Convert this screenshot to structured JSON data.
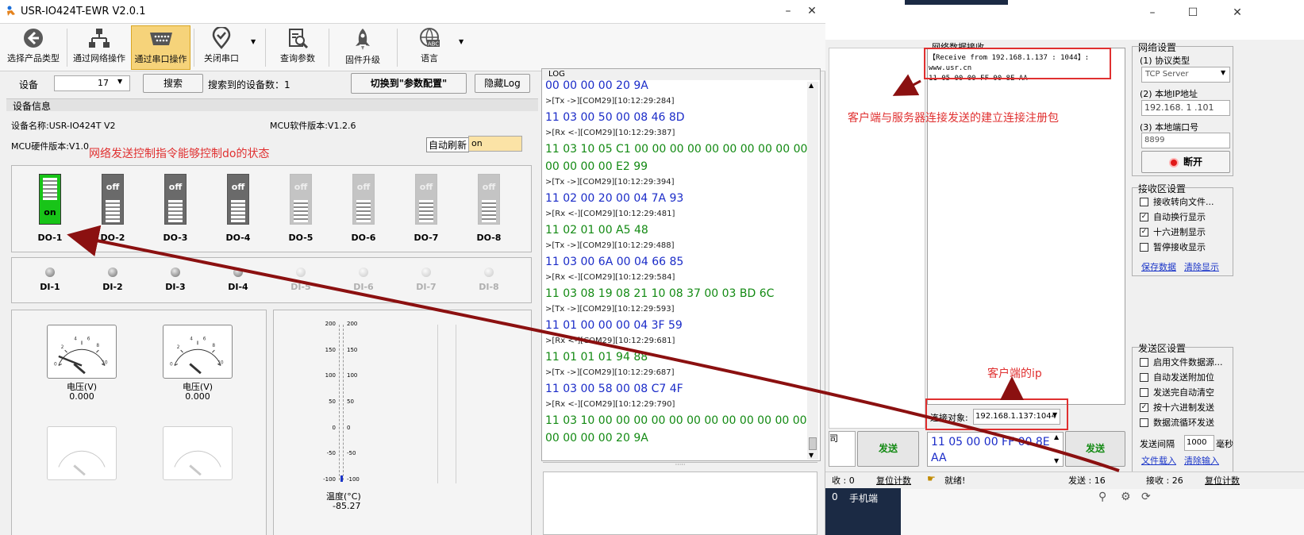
{
  "left_window": {
    "title": "USR-IO424T-EWR V2.0.1",
    "toolbar": [
      {
        "label": "选择产品类型",
        "icon": "back-arrow-icon"
      },
      {
        "label": "通过网络操作",
        "icon": "network-icon"
      },
      {
        "label": "通过串口操作",
        "icon": "serial-port-icon"
      },
      {
        "label": "关闭串口",
        "icon": "location-check-icon"
      },
      {
        "label": "查询参数",
        "icon": "search-document-icon"
      },
      {
        "label": "固件升级",
        "icon": "rocket-icon"
      },
      {
        "label": "语言",
        "icon": "globe-abc-icon"
      }
    ],
    "device_label": "设备",
    "device_value": "17",
    "search_button": "搜索",
    "found_label": "搜索到的设备数：1",
    "switch_button": "切换到\"参数配置\"",
    "hide_log_button": "隐藏Log",
    "device_info_title": "设备信息",
    "device_name": "设备名称:USR-IO424T V2",
    "mcu_soft": "MCU软件版本:V1.2.6",
    "mcu_hw": "MCU硬件版本:V1.0",
    "auto_refresh_label": "自动刷新",
    "auto_refresh_value": "on",
    "annotation_do": "网络发送控制指令能够控制do的状态",
    "do_switches": [
      {
        "label": "DO-1",
        "state": "on"
      },
      {
        "label": "DO-2",
        "state": "off"
      },
      {
        "label": "DO-3",
        "state": "off"
      },
      {
        "label": "DO-4",
        "state": "off"
      },
      {
        "label": "DO-5",
        "state": "off"
      },
      {
        "label": "DO-6",
        "state": "off"
      },
      {
        "label": "DO-7",
        "state": "off"
      },
      {
        "label": "DO-8",
        "state": "off"
      }
    ],
    "di_labels": [
      "DI-1",
      "DI-2",
      "DI-3",
      "DI-4",
      "DI-5",
      "DI-6",
      "DI-7",
      "DI-8"
    ],
    "gauges": [
      {
        "name": "电压(V)",
        "value": "0.000"
      },
      {
        "name": "电压(V)",
        "value": "0.000"
      }
    ],
    "thermo_ticks": [
      "200",
      "150",
      "100",
      "50",
      "0",
      "-50",
      "-100"
    ],
    "temp_label": "温度(°C)",
    "temp_value": "-85.27"
  },
  "log": {
    "title": "LOG",
    "lines": [
      {
        "type": "tx",
        "text": "00 00 00 00 20 9A"
      },
      {
        "type": "meta",
        "text": ">[Tx ->][COM29][10:12:29:284]"
      },
      {
        "type": "tx",
        "text": "11 03 00 50 00 08 46 8D"
      },
      {
        "type": "meta",
        "text": ">[Rx <-][COM29][10:12:29:387]"
      },
      {
        "type": "rx",
        "text": "11 03 10 05 C1 00 00 00 00 00 00 00 00 00 00"
      },
      {
        "type": "rx",
        "text": "00 00 00 00 E2 99"
      },
      {
        "type": "meta",
        "text": ">[Tx ->][COM29][10:12:29:394]"
      },
      {
        "type": "tx",
        "text": "11 02 00 20 00 04 7A 93"
      },
      {
        "type": "meta",
        "text": ">[Rx <-][COM29][10:12:29:481]"
      },
      {
        "type": "rx",
        "text": "11 02 01 00 A5 48"
      },
      {
        "type": "meta",
        "text": ">[Tx ->][COM29][10:12:29:488]"
      },
      {
        "type": "tx",
        "text": "11 03 00 6A 00 04 66 85"
      },
      {
        "type": "meta",
        "text": ">[Rx <-][COM29][10:12:29:584]"
      },
      {
        "type": "rx",
        "text": "11 03 08 19 08 21 10 08 37 00 03 BD 6C"
      },
      {
        "type": "meta",
        "text": ">[Tx ->][COM29][10:12:29:593]"
      },
      {
        "type": "tx",
        "text": "11 01 00 00 00 04 3F 59"
      },
      {
        "type": "meta",
        "text": ">[Rx <-][COM29][10:12:29:681]"
      },
      {
        "type": "rx",
        "text": "11 01 01 01 94 88"
      },
      {
        "type": "meta",
        "text": ">[Tx ->][COM29][10:12:29:687]"
      },
      {
        "type": "tx",
        "text": "11 03 00 58 00 08 C7 4F"
      },
      {
        "type": "meta",
        "text": ">[Rx <-][COM29][10:12:29:790]"
      },
      {
        "type": "rx",
        "text": "11 03 10 00 00 00 00 00 00 00 00 00 00 00 00"
      },
      {
        "type": "rx",
        "text": "00 00 00 00 20 9A"
      }
    ]
  },
  "right_window": {
    "recv_title": "网络数据接收",
    "recv_line1": "【Receive from 192.168.1.137 : 1044】:",
    "recv_line2": "www.usr.cn",
    "recv_line3": "11 05 00 00 FF 00 8E AA",
    "annotation_register": "客户端与服务器连接发送的建立连接注册包",
    "annotation_ip": "客户端的ip",
    "net_settings_title": "网络设置",
    "protocol_label": "(1) 协议类型",
    "protocol_value": "TCP Server",
    "local_ip_label": "(2) 本地IP地址",
    "local_ip_value": "192.168. 1 .101",
    "local_port_label": "(3) 本地端口号",
    "local_port_value": "8899",
    "disconnect_button": "断开",
    "recv_settings_title": "接收区设置",
    "recv_options": [
      {
        "label": "接收转向文件...",
        "checked": false
      },
      {
        "label": "自动换行显示",
        "checked": true
      },
      {
        "label": "十六进制显示",
        "checked": true
      },
      {
        "label": "暂停接收显示",
        "checked": false
      }
    ],
    "save_data_link": "保存数据",
    "clear_display_link": "清除显示",
    "send_settings_title": "发送区设置",
    "send_options": [
      {
        "label": "启用文件数据源...",
        "checked": false
      },
      {
        "label": "自动发送附加位",
        "checked": false
      },
      {
        "label": "发送完自动清空",
        "checked": false
      },
      {
        "label": "按十六进制发送",
        "checked": true
      },
      {
        "label": "数据流循环发送",
        "checked": false
      }
    ],
    "send_interval_label": "发送间隔",
    "send_interval_value": "1000",
    "send_interval_unit": "毫秒",
    "file_load_link": "文件载入",
    "clear_input_link": "清除输入",
    "target_label": "连接对象:",
    "target_value": "192.168.1.137:1044",
    "send_text": "11 05 00 00 FF 00 8E AA",
    "send_button": "发送",
    "left_send_button": "发送",
    "left_partial_text": "司",
    "status_ready": "就绪!",
    "status_send": "发送 : 16",
    "status_recv": "接收 : 26",
    "status_reset": "复位计数",
    "left_status_recv": "收 : 0",
    "left_status_reset": "复位计数",
    "taskbar_app": "手机端",
    "taskbar_number": "0"
  },
  "colors": {
    "annotation_red": "#e03030",
    "arrow_darkred": "#8b1010",
    "log_tx_blue": "#1a2bc8",
    "log_rx_green": "#138a13",
    "active_tool": "#f6d37a",
    "do_on_green": "#18c418"
  }
}
